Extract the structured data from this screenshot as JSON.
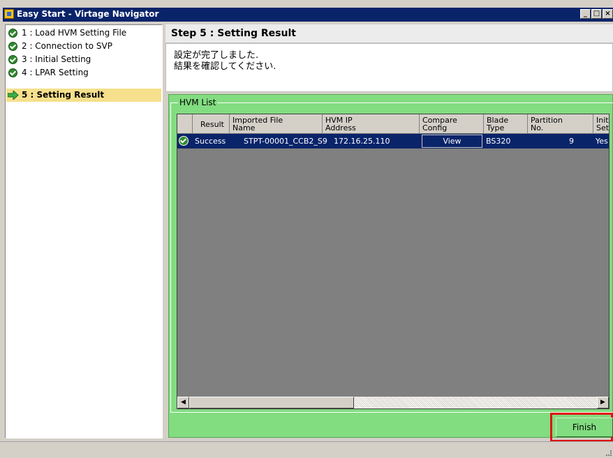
{
  "window": {
    "title": "Easy Start - Virtage Navigator",
    "controls": {
      "minimize": "_",
      "maximize": "□",
      "close": "×"
    }
  },
  "steps": [
    {
      "label": "1 : Load HVM Setting File",
      "status": "done",
      "icon": "check-icon"
    },
    {
      "label": "2 : Connection to SVP",
      "status": "done",
      "icon": "check-icon"
    },
    {
      "label": "3 : Initial Setting",
      "status": "done",
      "icon": "check-icon"
    },
    {
      "label": "4 : LPAR Setting",
      "status": "done",
      "icon": "check-icon"
    },
    {
      "label": "5 : Setting Result",
      "status": "current",
      "icon": "arrow-right-icon"
    }
  ],
  "content": {
    "step_title": "Step 5 : Setting Result",
    "message_line1": "設定が完了しました.",
    "message_line2": "結果を確認してください."
  },
  "hvm_list": {
    "title": "HVM List",
    "columns": [
      {
        "line1": "Result",
        "line2": ""
      },
      {
        "line1": "Imported File",
        "line2": "Name"
      },
      {
        "line1": "HVM IP",
        "line2": "Address"
      },
      {
        "line1": "Compare",
        "line2": "Config"
      },
      {
        "line1": "Blade",
        "line2": "Type"
      },
      {
        "line1": "Partition",
        "line2": "No."
      },
      {
        "line1": "Init",
        "line2": "Set"
      }
    ],
    "rows": [
      {
        "result": "Success",
        "file_name": "STPT-00001_CCB2_S9",
        "ip": "172.16.25.110",
        "compare": "View",
        "blade_type": "BS320",
        "partition": "9",
        "init": "Yes"
      }
    ],
    "scroll_left": "◀",
    "scroll_right": "▶"
  },
  "buttons": {
    "finish": "Finish"
  },
  "colors": {
    "accent_green": "#82dc80",
    "selection": "#0a246a",
    "highlight_red": "#e01010",
    "active_step": "#f6e08c"
  }
}
